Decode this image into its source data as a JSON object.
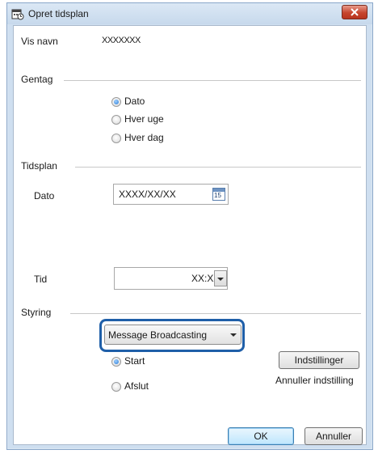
{
  "window": {
    "title": "Opret tidsplan"
  },
  "fields": {
    "display_name_label": "Vis navn",
    "display_name_value": "XXXXXXX"
  },
  "repeat": {
    "group_label": "Gentag",
    "options": [
      "Dato",
      "Hver uge",
      "Hver dag"
    ],
    "selected": "Dato"
  },
  "schedule": {
    "group_label": "Tidsplan",
    "date_label": "Dato",
    "date_value": "XXXX/XX/XX",
    "calendar_day": "15",
    "time_label": "Tid",
    "time_value": "XX:XX"
  },
  "control": {
    "group_label": "Styring",
    "dropdown_value": "Message Broadcasting",
    "actions": [
      "Start",
      "Afslut"
    ],
    "selected": "Start",
    "settings_button": "Indstillinger",
    "cancel_setting_link": "Annuller indstilling"
  },
  "footer": {
    "ok_label": "OK",
    "cancel_label": "Annuller"
  },
  "icons": {
    "app": "scheduler-icon",
    "close": "close-icon",
    "calendar": "calendar-icon",
    "dropdown": "chevron-down-icon"
  },
  "colors": {
    "highlight": "#1f5fa8",
    "close_button": "#c6452e",
    "radio_selected": "#2b7bd6"
  }
}
